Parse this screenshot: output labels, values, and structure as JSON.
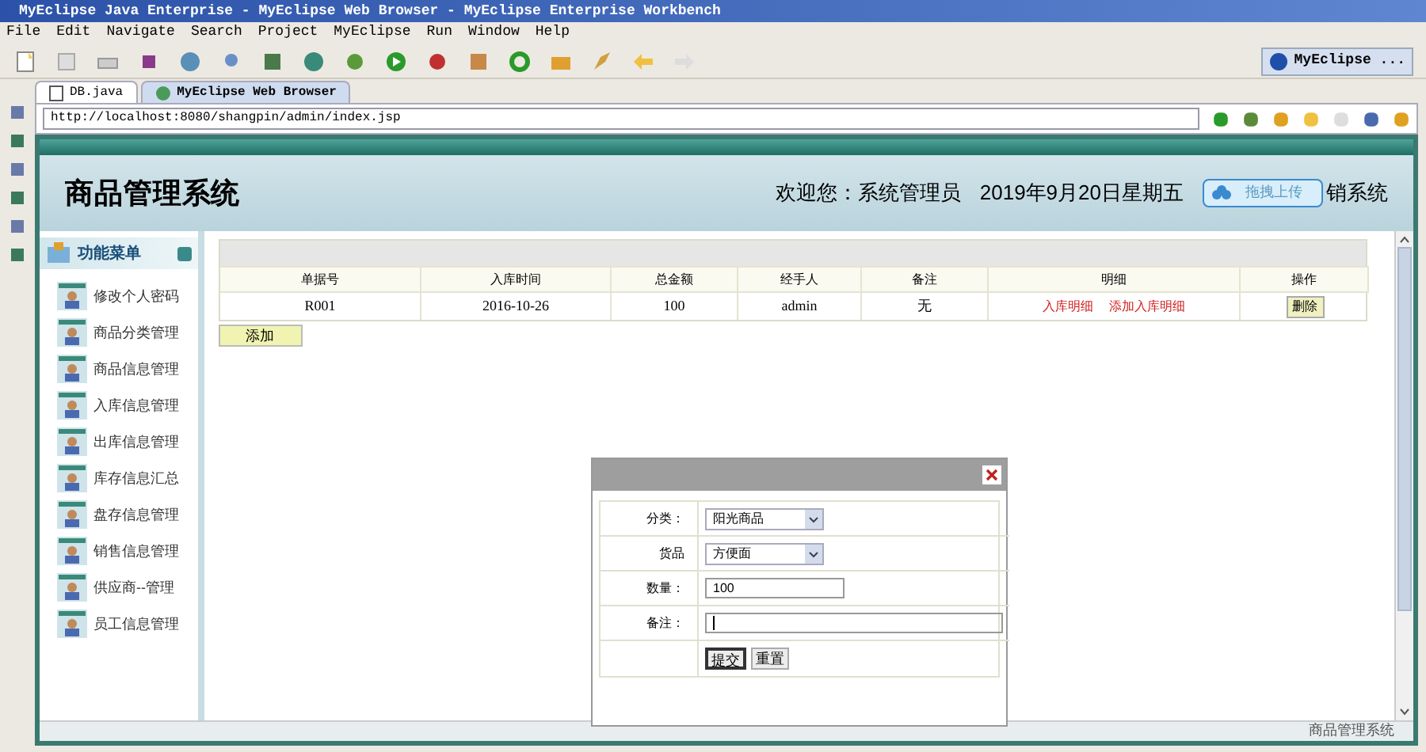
{
  "window": {
    "title": "MyEclipse Java Enterprise - MyEclipse Web Browser - MyEclipse Enterprise Workbench"
  },
  "menu": [
    "File",
    "Edit",
    "Navigate",
    "Search",
    "Project",
    "MyEclipse",
    "Run",
    "Window",
    "Help"
  ],
  "perspective": "MyEclipse ...",
  "editor_tabs": [
    {
      "label": "DB.java",
      "selected": false,
      "kind": "java"
    },
    {
      "label": "MyEclipse Web Browser",
      "selected": true,
      "kind": "browser"
    }
  ],
  "url": "http://localhost:8080/shangpin/admin/index.jsp",
  "page": {
    "title": "商品管理系统",
    "welcome": "欢迎您：系统管理员",
    "date": "2019年9月20日星期五",
    "upload_button": "拖拽上传",
    "logout": "销系统",
    "sidebar": {
      "title": "功能菜单",
      "items": [
        "修改个人密码",
        "商品分类管理",
        "商品信息管理",
        "入库信息管理",
        "出库信息管理",
        "库存信息汇总",
        "盘存信息管理",
        "销售信息管理",
        "供应商--管理",
        "员工信息管理"
      ]
    },
    "table": {
      "columns": [
        "单据号",
        "入库时间",
        "总金额",
        "经手人",
        "备注",
        "明细",
        "操作"
      ],
      "rows": [
        {
          "cells": [
            "R001",
            "2016-10-26",
            "100",
            "admin",
            "无"
          ],
          "links": [
            "入库明细",
            "添加入库明细"
          ],
          "action": "删除"
        }
      ]
    },
    "add_button": "添加",
    "dialog": {
      "fields": [
        {
          "label": "分类：",
          "kind": "select",
          "value": "阳光商品"
        },
        {
          "label": "货品",
          "kind": "select",
          "value": "方便面"
        },
        {
          "label": "数量：",
          "kind": "input",
          "value": "100"
        },
        {
          "label": "备注：",
          "kind": "wide-input"
        }
      ],
      "buttons": [
        "提交",
        "重置"
      ]
    },
    "status": "商品管理系统"
  }
}
